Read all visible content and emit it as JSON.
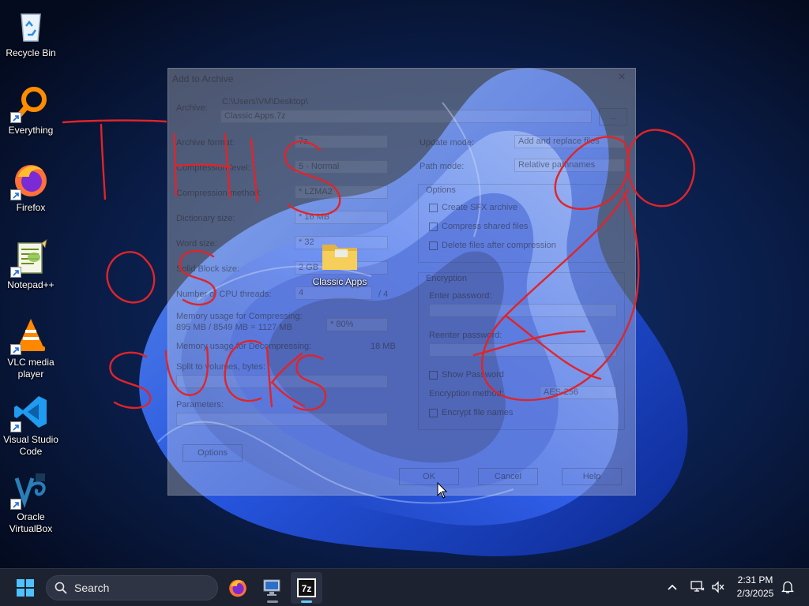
{
  "desktop": {
    "icons": [
      {
        "label": "Recycle Bin",
        "icon": "recycle-bin-icon"
      },
      {
        "label": "Everything",
        "icon": "everything-search-icon"
      },
      {
        "label": "Firefox",
        "icon": "firefox-icon"
      },
      {
        "label": "Notepad++",
        "icon": "notepadpp-icon"
      },
      {
        "label": "VLC media player",
        "icon": "vlc-icon"
      },
      {
        "label": "Visual Studio Code",
        "icon": "vscode-icon"
      },
      {
        "label": "Oracle VirtualBox",
        "icon": "virtualbox-icon"
      }
    ],
    "folder": {
      "label": "Classic Apps",
      "icon": "folder-icon"
    },
    "scribble_text": "THIS OS SUCKS"
  },
  "dialog": {
    "title": "Add to Archive",
    "close": "×",
    "archive_label": "Archive:",
    "archive_path": "C:\\Users\\VM\\Desktop\\",
    "archive_name": "Classic Apps.7z",
    "browse": "...",
    "fields": [
      {
        "label": "Archive format:",
        "value": "7z"
      },
      {
        "label": "Compression level:",
        "value": "5 - Normal"
      },
      {
        "label": "Compression method:",
        "value": "* LZMA2"
      },
      {
        "label": "Dictionary size:",
        "value": "* 16 MB"
      },
      {
        "label": "Word size:",
        "value": "* 32"
      },
      {
        "label": "Solid Block size:",
        "value": "2 GB"
      },
      {
        "label": "Number of CPU threads:",
        "value": "4"
      }
    ],
    "threads_total": "/ 4",
    "memory_compress_label": "Memory usage for Compressing:",
    "memory_compress_value": "895 MB / 8549 MB = 1127 MB",
    "memory_compress_pct": "* 80%",
    "memory_decompress_label": "Memory usage for Decompressing:",
    "memory_decompress_value": "18 MB",
    "split_label": "Split to volumes, bytes:",
    "params_label": "Parameters:",
    "options_button": "Options",
    "update_mode_label": "Update mode:",
    "update_mode_value": "Add and replace files",
    "path_mode_label": "Path mode:",
    "path_mode_value": "Relative pathnames",
    "options_group": "Options",
    "option_checks": [
      "Create SFX archive",
      "Compress shared files",
      "Delete files after compression"
    ],
    "encryption_group": "Encryption",
    "enter_password": "Enter password:",
    "reenter_password": "Reenter password:",
    "show_password": "Show Password",
    "encryption_method_label": "Encryption method:",
    "encryption_method_value": "AES-256",
    "encrypt_names": "Encrypt file names",
    "ok": "OK",
    "cancel": "Cancel",
    "help": "Help"
  },
  "taskbar": {
    "search_placeholder": "Search",
    "apps": [
      "start-icon",
      "firefox-icon",
      "remote-desktop-icon",
      "7zip-icon"
    ],
    "time": "2:31 PM",
    "date": "2/3/2025"
  },
  "colors": {
    "wallpaper_dark": "#06122e",
    "wallpaper_blue": "#2f6bff",
    "scribble_red": "#e0242a",
    "taskbar": "#1c2230",
    "accent": "#60cdff"
  }
}
